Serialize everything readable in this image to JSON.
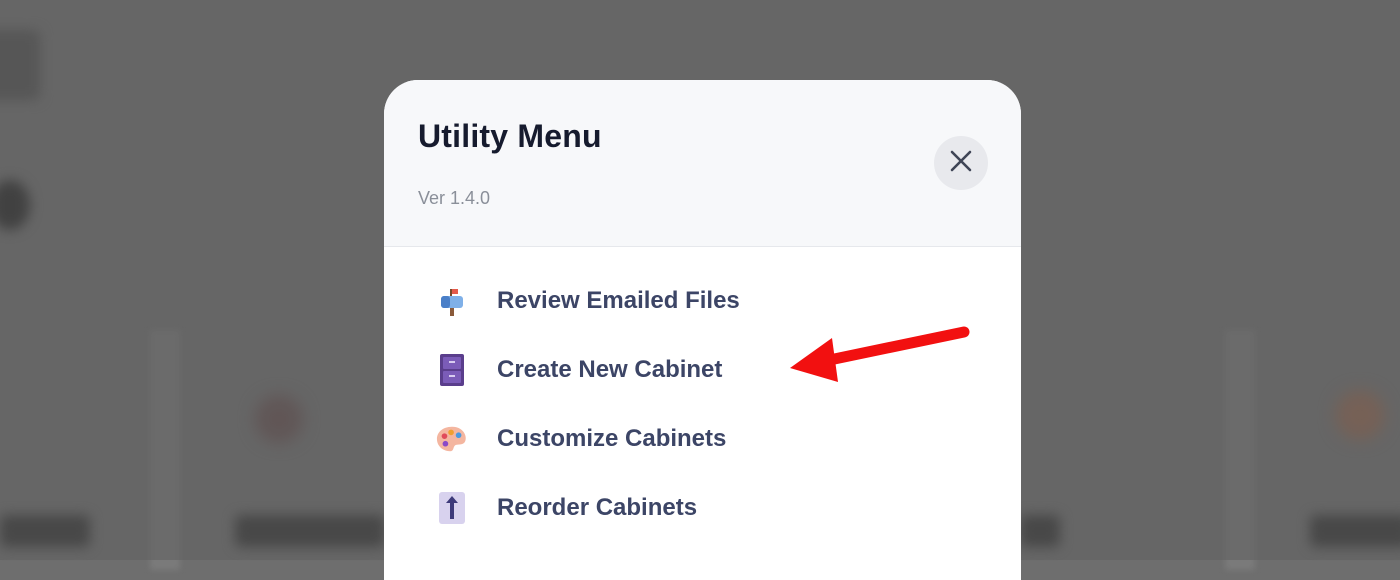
{
  "modal": {
    "title": "Utility Menu",
    "version": "Ver 1.4.0",
    "close_icon": "close-icon"
  },
  "menu": {
    "items": [
      {
        "label": "Review Emailed Files",
        "icon": "mailbox-icon"
      },
      {
        "label": "Create New Cabinet",
        "icon": "file-cabinet-icon"
      },
      {
        "label": "Customize Cabinets",
        "icon": "palette-icon"
      },
      {
        "label": "Reorder Cabinets",
        "icon": "reorder-icon"
      }
    ]
  },
  "annotation": {
    "arrow_color": "#f21010",
    "points_to": "Create New Cabinet"
  },
  "colors": {
    "backdrop": "#6e6e6e",
    "header_bg": "#f7f8fa",
    "title": "#161b2e",
    "menu_text": "#3c4566"
  }
}
